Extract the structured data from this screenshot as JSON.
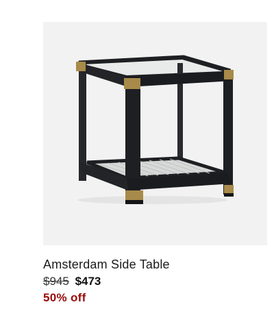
{
  "product": {
    "image_icon": "side-table-product-image",
    "title": "Amsterdam Side Table",
    "price_original": "$945",
    "price_sale": "$473",
    "discount": "50% off"
  },
  "colors": {
    "image_background": "#f2f2f2",
    "discount": "#9b0a0a",
    "frame": "#1e1f22",
    "brass": "#a88a4a"
  }
}
